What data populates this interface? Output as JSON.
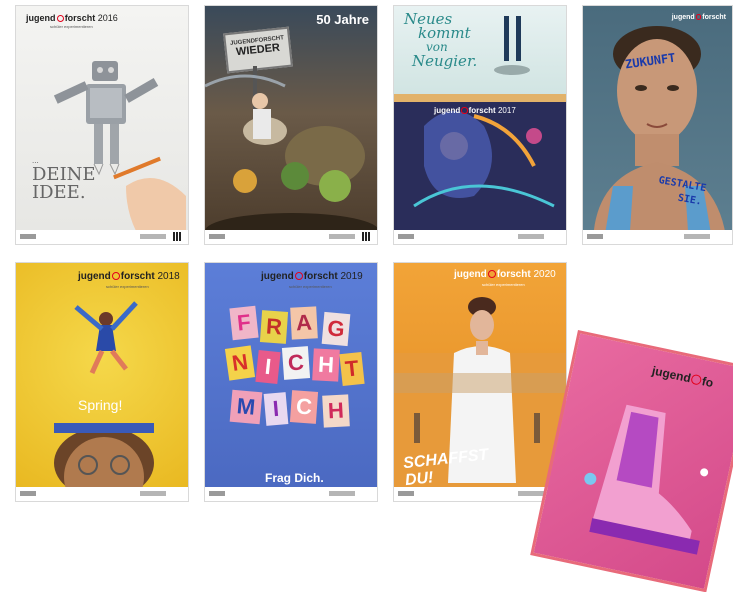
{
  "posters": [
    {
      "brand_a": "jugend",
      "brand_b": "forscht",
      "year": "2016",
      "sub": "schüler experimentieren",
      "headline_line1": "...",
      "headline_line2": "DEINE",
      "headline_line3": "IDEE."
    },
    {
      "headline_line1": "50 Jahre",
      "sign_line1": "JUGENDFORSCHT",
      "sign_line2": "WIEDER"
    },
    {
      "headline_line1": "Neues",
      "headline_line2": "kommt",
      "headline_line3": "von",
      "headline_line4": "Neugier.",
      "brand_a": "jugend",
      "brand_b": "forscht",
      "year": "2017"
    },
    {
      "brand_a": "jugend",
      "brand_b": "forscht",
      "word_forehead": "ZUKUNFT",
      "word_chest1": "GESTALTE",
      "word_chest2": "SIE."
    },
    {
      "brand_a": "jugend",
      "brand_b": "forscht",
      "year": "2018",
      "sub": "schüler experimentieren",
      "headline": "Spring!"
    },
    {
      "brand_a": "jugend",
      "brand_b": "forscht",
      "year": "2019",
      "sub": "schüler experimentieren",
      "tiles": [
        "F",
        "R",
        "A",
        "G",
        "N",
        "I",
        "C",
        "H",
        "T",
        "M",
        "I",
        "C",
        "H"
      ],
      "headline": "Frag Dich."
    },
    {
      "brand_a": "jugend",
      "brand_b": "forscht",
      "year": "2020",
      "sub": "schüler experimentieren",
      "headline": "SCHAFFST DU!"
    },
    {
      "brand_a": "jugend",
      "brand_b": "fo"
    }
  ]
}
